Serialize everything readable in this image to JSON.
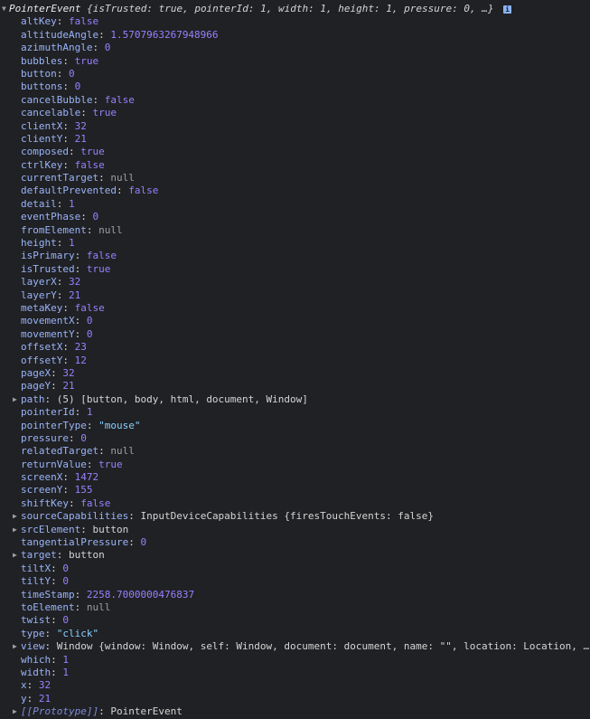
{
  "header": {
    "class_name": "PointerEvent",
    "preview": "{isTrusted: true, pointerId: 1, width: 1, height: 1, pressure: 0, …}",
    "info_glyph": "i"
  },
  "properties": [
    {
      "key": "altKey",
      "value": "false",
      "type": "bool",
      "expandable": false
    },
    {
      "key": "altitudeAngle",
      "value": "1.5707963267948966",
      "type": "num",
      "expandable": false
    },
    {
      "key": "azimuthAngle",
      "value": "0",
      "type": "num",
      "expandable": false
    },
    {
      "key": "bubbles",
      "value": "true",
      "type": "bool",
      "expandable": false
    },
    {
      "key": "button",
      "value": "0",
      "type": "num",
      "expandable": false
    },
    {
      "key": "buttons",
      "value": "0",
      "type": "num",
      "expandable": false
    },
    {
      "key": "cancelBubble",
      "value": "false",
      "type": "bool",
      "expandable": false
    },
    {
      "key": "cancelable",
      "value": "true",
      "type": "bool",
      "expandable": false
    },
    {
      "key": "clientX",
      "value": "32",
      "type": "num",
      "expandable": false
    },
    {
      "key": "clientY",
      "value": "21",
      "type": "num",
      "expandable": false
    },
    {
      "key": "composed",
      "value": "true",
      "type": "bool",
      "expandable": false
    },
    {
      "key": "ctrlKey",
      "value": "false",
      "type": "bool",
      "expandable": false
    },
    {
      "key": "currentTarget",
      "value": "null",
      "type": "nul",
      "expandable": false
    },
    {
      "key": "defaultPrevented",
      "value": "false",
      "type": "bool",
      "expandable": false
    },
    {
      "key": "detail",
      "value": "1",
      "type": "num",
      "expandable": false
    },
    {
      "key": "eventPhase",
      "value": "0",
      "type": "num",
      "expandable": false
    },
    {
      "key": "fromElement",
      "value": "null",
      "type": "nul",
      "expandable": false
    },
    {
      "key": "height",
      "value": "1",
      "type": "num",
      "expandable": false
    },
    {
      "key": "isPrimary",
      "value": "false",
      "type": "bool",
      "expandable": false
    },
    {
      "key": "isTrusted",
      "value": "true",
      "type": "bool",
      "expandable": false
    },
    {
      "key": "layerX",
      "value": "32",
      "type": "num",
      "expandable": false
    },
    {
      "key": "layerY",
      "value": "21",
      "type": "num",
      "expandable": false
    },
    {
      "key": "metaKey",
      "value": "false",
      "type": "bool",
      "expandable": false
    },
    {
      "key": "movementX",
      "value": "0",
      "type": "num",
      "expandable": false
    },
    {
      "key": "movementY",
      "value": "0",
      "type": "num",
      "expandable": false
    },
    {
      "key": "offsetX",
      "value": "23",
      "type": "num",
      "expandable": false
    },
    {
      "key": "offsetY",
      "value": "12",
      "type": "num",
      "expandable": false
    },
    {
      "key": "pageX",
      "value": "32",
      "type": "num",
      "expandable": false
    },
    {
      "key": "pageY",
      "value": "21",
      "type": "num",
      "expandable": false
    },
    {
      "key": "path",
      "value": "(5) [button, body, html, document, Window]",
      "type": "obj",
      "expandable": true
    },
    {
      "key": "pointerId",
      "value": "1",
      "type": "num",
      "expandable": false
    },
    {
      "key": "pointerType",
      "value": "\"mouse\"",
      "type": "str",
      "expandable": false
    },
    {
      "key": "pressure",
      "value": "0",
      "type": "num",
      "expandable": false
    },
    {
      "key": "relatedTarget",
      "value": "null",
      "type": "nul",
      "expandable": false
    },
    {
      "key": "returnValue",
      "value": "true",
      "type": "bool",
      "expandable": false
    },
    {
      "key": "screenX",
      "value": "1472",
      "type": "num",
      "expandable": false
    },
    {
      "key": "screenY",
      "value": "155",
      "type": "num",
      "expandable": false
    },
    {
      "key": "shiftKey",
      "value": "false",
      "type": "bool",
      "expandable": false
    },
    {
      "key": "sourceCapabilities",
      "value": "InputDeviceCapabilities {firesTouchEvents: false}",
      "type": "obj",
      "expandable": true
    },
    {
      "key": "srcElement",
      "value": "button",
      "type": "obj",
      "expandable": true
    },
    {
      "key": "tangentialPressure",
      "value": "0",
      "type": "num",
      "expandable": false
    },
    {
      "key": "target",
      "value": "button",
      "type": "obj",
      "expandable": true
    },
    {
      "key": "tiltX",
      "value": "0",
      "type": "num",
      "expandable": false
    },
    {
      "key": "tiltY",
      "value": "0",
      "type": "num",
      "expandable": false
    },
    {
      "key": "timeStamp",
      "value": "2258.7000000476837",
      "type": "num",
      "expandable": false
    },
    {
      "key": "toElement",
      "value": "null",
      "type": "nul",
      "expandable": false
    },
    {
      "key": "twist",
      "value": "0",
      "type": "num",
      "expandable": false
    },
    {
      "key": "type",
      "value": "\"click\"",
      "type": "str",
      "expandable": false
    },
    {
      "key": "view",
      "value": "Window {window: Window, self: Window, document: document, name: \"\", location: Location, …}",
      "type": "obj",
      "expandable": true
    },
    {
      "key": "which",
      "value": "1",
      "type": "num",
      "expandable": false
    },
    {
      "key": "width",
      "value": "1",
      "type": "num",
      "expandable": false
    },
    {
      "key": "x",
      "value": "32",
      "type": "num",
      "expandable": false
    },
    {
      "key": "y",
      "value": "21",
      "type": "num",
      "expandable": false
    },
    {
      "key": "[[Prototype]]",
      "value": "PointerEvent",
      "type": "obj",
      "expandable": true,
      "proto": true
    }
  ],
  "colors": {
    "background": "#202124",
    "key": "#9ab4f9",
    "number_bool": "#9980ff",
    "null": "#9aa0a6",
    "string": "#8ad0ff",
    "text": "#d5d5d5"
  },
  "icons": {
    "expanded": "triangle-down-icon",
    "collapsed": "triangle-right-icon",
    "info": "info-badge-icon"
  }
}
